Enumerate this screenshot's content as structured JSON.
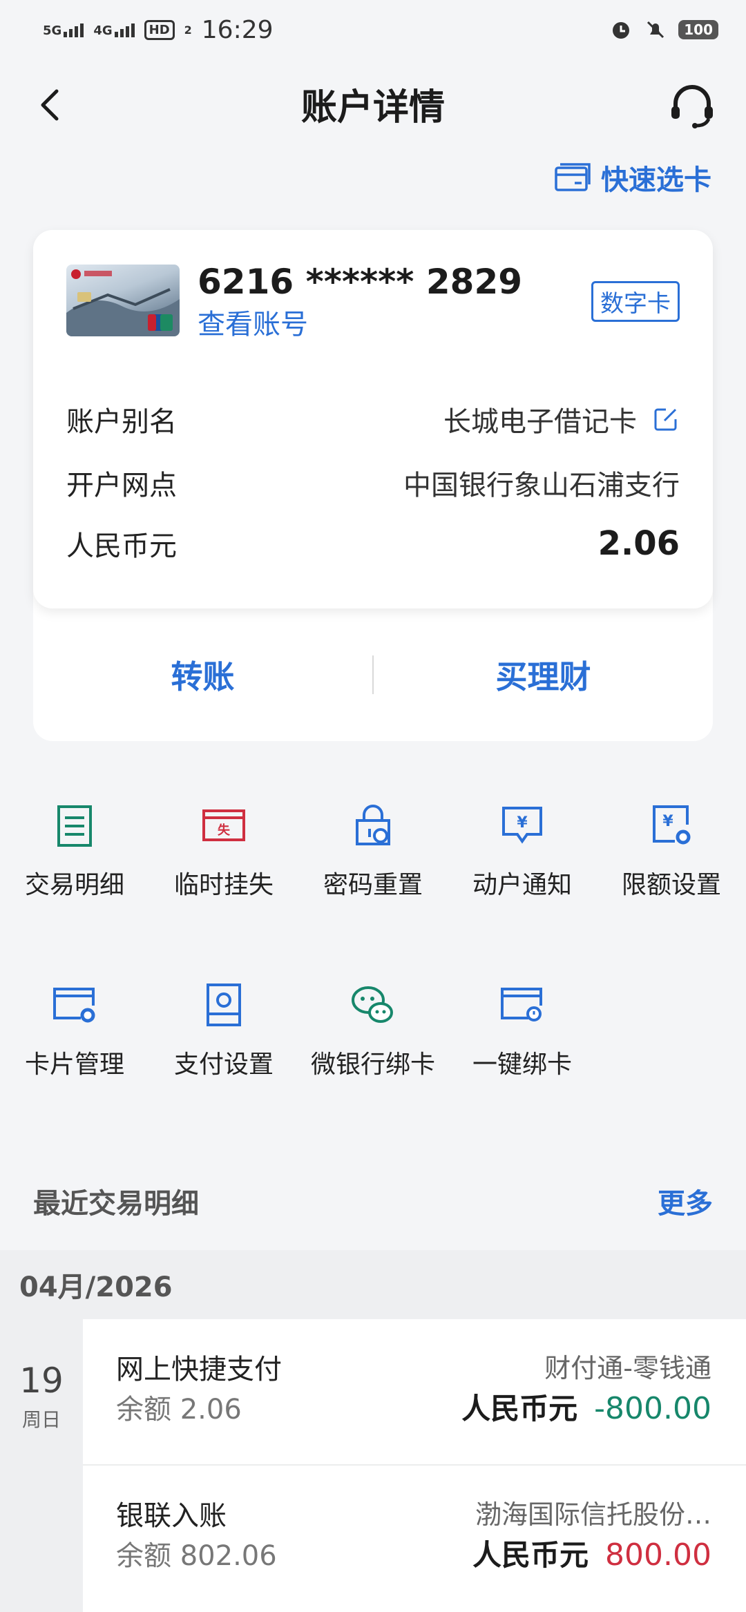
{
  "status_bar": {
    "net1": "5G",
    "net2": "4G",
    "hd": "HD",
    "hd_sub": "2",
    "time": "16:29",
    "battery": "100"
  },
  "header": {
    "title": "账户详情"
  },
  "quick_select": {
    "label": "快速选卡"
  },
  "card": {
    "number": "6216 ****** 2829",
    "view_account": "查看账号",
    "badge": "数字卡",
    "rows": [
      {
        "label": "账户别名",
        "value": "长城电子借记卡"
      },
      {
        "label": "开户网点",
        "value": "中国银行象山石浦支行"
      },
      {
        "label": "人民币元",
        "value": "2.06"
      }
    ],
    "actions": [
      "转账",
      "买理财"
    ]
  },
  "services": [
    {
      "label": "交易明细",
      "icon": "list-icon",
      "color": "#17876b"
    },
    {
      "label": "临时挂失",
      "icon": "loss-report-icon",
      "color": "#cf2f40"
    },
    {
      "label": "密码重置",
      "icon": "password-reset-icon",
      "color": "#2a6fd6"
    },
    {
      "label": "动户通知",
      "icon": "notification-icon",
      "color": "#2a6fd6"
    },
    {
      "label": "限额设置",
      "icon": "limit-settings-icon",
      "color": "#2a6fd6"
    },
    {
      "label": "卡片管理",
      "icon": "card-manage-icon",
      "color": "#2a6fd6"
    },
    {
      "label": "支付设置",
      "icon": "payment-settings-icon",
      "color": "#2a6fd6"
    },
    {
      "label": "微银行绑卡",
      "icon": "wechat-icon",
      "color": "#17876b"
    },
    {
      "label": "一键绑卡",
      "icon": "quick-bind-icon",
      "color": "#2a6fd6"
    }
  ],
  "recent": {
    "title": "最近交易明细",
    "more": "更多",
    "month": "04月/2026",
    "day": "19",
    "weekday": "周日",
    "transactions": [
      {
        "name": "网上快捷支付",
        "balance_label": "余额",
        "balance": "2.06",
        "party": "财付通-零钱通",
        "currency": "人民币元",
        "amount": "-800.00"
      },
      {
        "name": "银联入账",
        "balance_label": "余额",
        "balance": "802.06",
        "party": "渤海国际信托股份…",
        "currency": "人民币元",
        "amount": "800.00"
      }
    ]
  }
}
